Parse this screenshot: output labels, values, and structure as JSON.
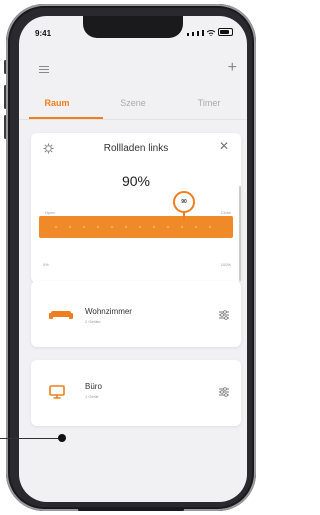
{
  "status": {
    "time": "9:41"
  },
  "tabs": [
    {
      "label": "Raum",
      "active": true
    },
    {
      "label": "Szene",
      "active": false
    },
    {
      "label": "Timer",
      "active": false
    }
  ],
  "blind_card": {
    "title": "Rollladen links",
    "percent_label": "90%",
    "open_label": "Open",
    "close_label": "Close",
    "min_label": "0%",
    "max_label": "100%",
    "handle_value": "90",
    "position_fraction": 0.9
  },
  "rooms": [
    {
      "name": "Wohnzimmer",
      "sub": "2 Geräte",
      "icon": "sofa-icon"
    },
    {
      "name": "Büro",
      "sub": "1 Gerät",
      "icon": "monitor-icon"
    }
  ],
  "colors": {
    "accent": "#f07e1f",
    "background": "#f1f1f3",
    "card": "#ffffff"
  },
  "icons": [
    "menu-icon",
    "plus-icon",
    "gear-icon",
    "close-icon",
    "sofa-icon",
    "monitor-icon",
    "settings-icon"
  ]
}
